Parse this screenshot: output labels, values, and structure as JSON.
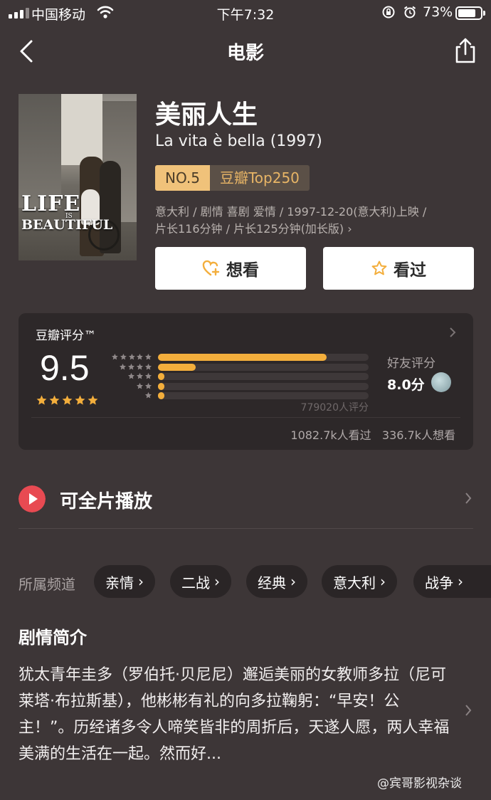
{
  "status_bar": {
    "carrier": "中国移动",
    "time": "下午7:32",
    "battery_percent": "73%"
  },
  "nav": {
    "title": "电影"
  },
  "movie": {
    "title_cn": "美丽人生",
    "title_original": "La vita è bella (1997)",
    "rank_no": "NO.5",
    "rank_list": "豆瓣Top250",
    "meta_line1": "意大利 / 剧情 喜剧 爱情 / 1997-12-20(意大利)上映 /",
    "meta_line2": "片长116分钟 / 片长125分钟(加长版)",
    "poster": {
      "title_life": "LIFE",
      "title_is": "IS",
      "title_beautiful": "BEAUTIFUL"
    }
  },
  "buttons": {
    "wish": "想看",
    "seen": "看过"
  },
  "rating": {
    "label": "豆瓣评分™",
    "score": "9.5",
    "stars": 5,
    "distribution": [
      {
        "stars": 5,
        "percent": 80
      },
      {
        "stars": 4,
        "percent": 18
      },
      {
        "stars": 3,
        "percent": 3
      },
      {
        "stars": 2,
        "percent": 3
      },
      {
        "stars": 1,
        "percent": 3
      }
    ],
    "count": "779020人评分",
    "friend_label": "好友评分",
    "friend_score": "8.0分",
    "watched": "1082.7k人看过",
    "wanted": "336.7k人想看",
    "accent_color": "#f3ae3c"
  },
  "play": {
    "label": "可全片播放",
    "icon": "play-icon",
    "color": "#e84a52"
  },
  "channels": {
    "label": "所属频道",
    "tags": [
      "亲情",
      "二战",
      "经典",
      "意大利",
      "战争"
    ]
  },
  "synopsis": {
    "title": "剧情简介",
    "text": "犹太青年圭多（罗伯托·贝尼尼）邂逅美丽的女教师多拉（尼可莱塔·布拉斯基），他彬彬有礼的向多拉鞠躬：“早安！公主！”。历经诸多令人啼笑皆非的周折后，天遂人愿，两人幸福美满的生活在一起。然而好..."
  },
  "watermark": "@宾哥影视杂谈"
}
